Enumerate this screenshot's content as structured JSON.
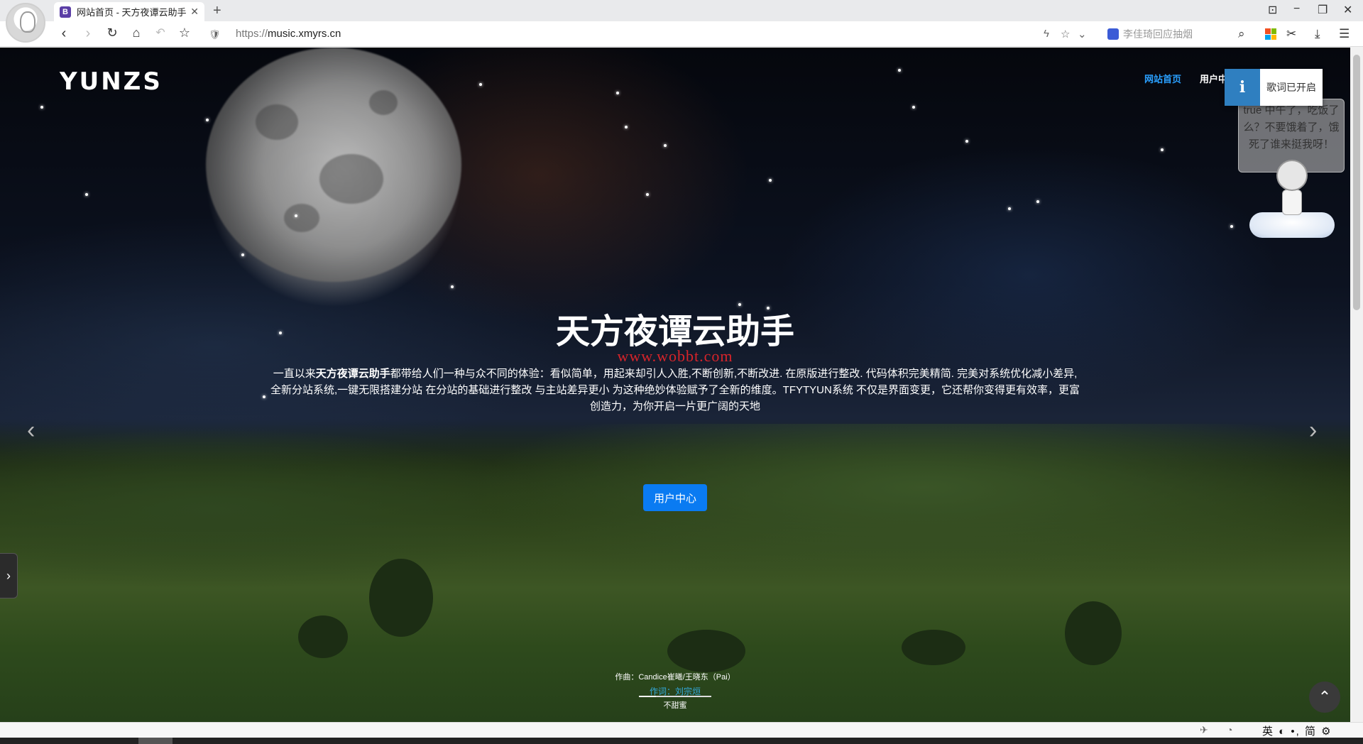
{
  "browser": {
    "tab_title": "网站首页 - 天方夜谭云助手",
    "tab_favicon": "B",
    "url_protocol": "https://",
    "url_host": "music.xmyrs.cn",
    "search_placeholder": "李佳琦回应抽烟",
    "ime_text": "英 ◐ •, 简 ⚙"
  },
  "site": {
    "logo": "YUNZS",
    "nav": {
      "home": "网站首页",
      "user": "用户中心"
    },
    "toast": {
      "icon": "i",
      "message": "歌词已开启"
    },
    "mascot_bubble": "true 中午了，吃饭了么？不要饿着了，饿死了谁来挺我呀！",
    "hero": {
      "title": "天方夜谭云助手",
      "watermark": "www.wobbt.com",
      "desc_prefix": "一直以来",
      "desc_bold": "天方夜谭云助手",
      "desc_rest": "都带给人们一种与众不同的体验：看似简单，用起来却引人入胜,不断创新,不断改进. 在原版进行整改. 代码体积完美精简. 完美对系统优化减小差异, 全新分站系统,一键无限搭建分站 在分站的基础进行整改 与主站差异更小 为这种绝妙体验赋予了全新的维度。TFYTYUN系统 不仅是界面变更，它还帮你变得更有效率，更富创造力，为你开启一片更广阔的天地",
      "button": "用户中心"
    },
    "lyrics": {
      "line1": "作曲：Candice崔曦/王晓东（Pai）",
      "line2": "作词：刘宗烜",
      "line3": "不甜蜜",
      "progress": 0.24
    },
    "colors": {
      "accent": "#0a7bf2",
      "nav_active": "#2aa0ff",
      "watermark": "#d8242a",
      "toast_icon": "#2f7fc0"
    }
  }
}
